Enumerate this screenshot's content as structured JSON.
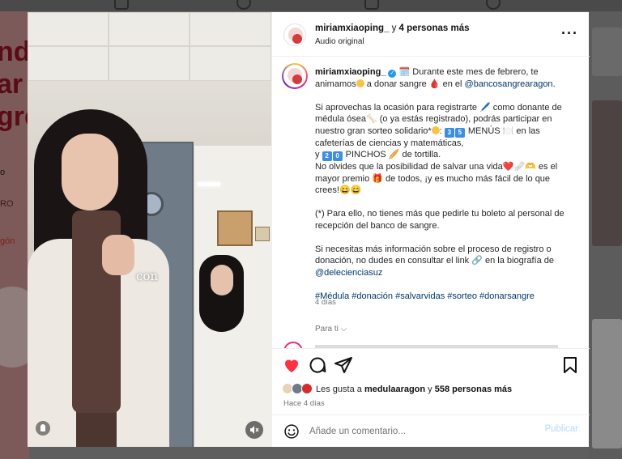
{
  "background": {
    "promo_lines": [
      "nd",
      "ar",
      "gre"
    ],
    "promo_small": [
      "o",
      "RO",
      "gón"
    ]
  },
  "video": {
    "subtitle": "con"
  },
  "header": {
    "username": "miriamxiaoping_",
    "connector": "y",
    "others": "4 personas más",
    "audio": "Audio original"
  },
  "post": {
    "username": "miriamxiaoping_",
    "verified_mark": "✓",
    "p1_a": "🗓️ Durante este mes de febrero, te animamos",
    "p1_b": " a donar sangre 🩸 en el ",
    "p1_mention": "@bancosangrearagon",
    "p1_end": ".",
    "p2_a": "Si aprovechas la ocasión para registrarte 🖊️ como donante de médula ósea🦴 (o ya estás registrado), podrás participar en nuestro gran sorteo solidario*",
    "p2_b": ": ",
    "p2_key1": "3",
    "p2_key2": "5",
    "p2_c": " MENÚS 🍽️ en las cafeterías de ciencias y matemáticas,",
    "p2_d": "y ",
    "p2_key3": "2",
    "p2_key4": "0",
    "p2_e": " PINCHOS 🥖 de tortilla.",
    "p2_f": "No olvides que la posibilidad de salvar una vida❤️🩹🫶 es el mayor premio 🎁 de todos, ¡y es mucho más fácil de lo que crees!😄😄",
    "p3": "(*) Para ello, no tienes más que pedirle tu boleto al personal de recepción del banco de sangre.",
    "p4_a": "Si necesitas más información sobre el proceso de registro o donación, no dudes en consultar el link 🔗 en la biografía de ",
    "p4_mention": "@delecienciasuz",
    "tags": "#Médula #donación #salvarvidas #sorteo #donarsangre",
    "time": "4 días",
    "for_you": "Para ti"
  },
  "actions": {
    "likes_prefix": "Les gusta a ",
    "likes_user": "medulaaragon",
    "likes_connector": " y ",
    "likes_count": "558 personas más",
    "ago": "Hace 4 días"
  },
  "comment": {
    "placeholder": "Añade un comentario...",
    "publish": "Publicar"
  },
  "colors": {
    "heart": "#ff3040",
    "link": "#00376b",
    "publish_disabled": "#b3dbff",
    "verified": "#1d9bf0"
  },
  "icons": [
    "heart-icon",
    "comment-icon",
    "share-icon",
    "bookmark-icon",
    "more-icon",
    "emoji-icon",
    "mute-icon",
    "user-icon",
    "chevron-down-icon"
  ]
}
